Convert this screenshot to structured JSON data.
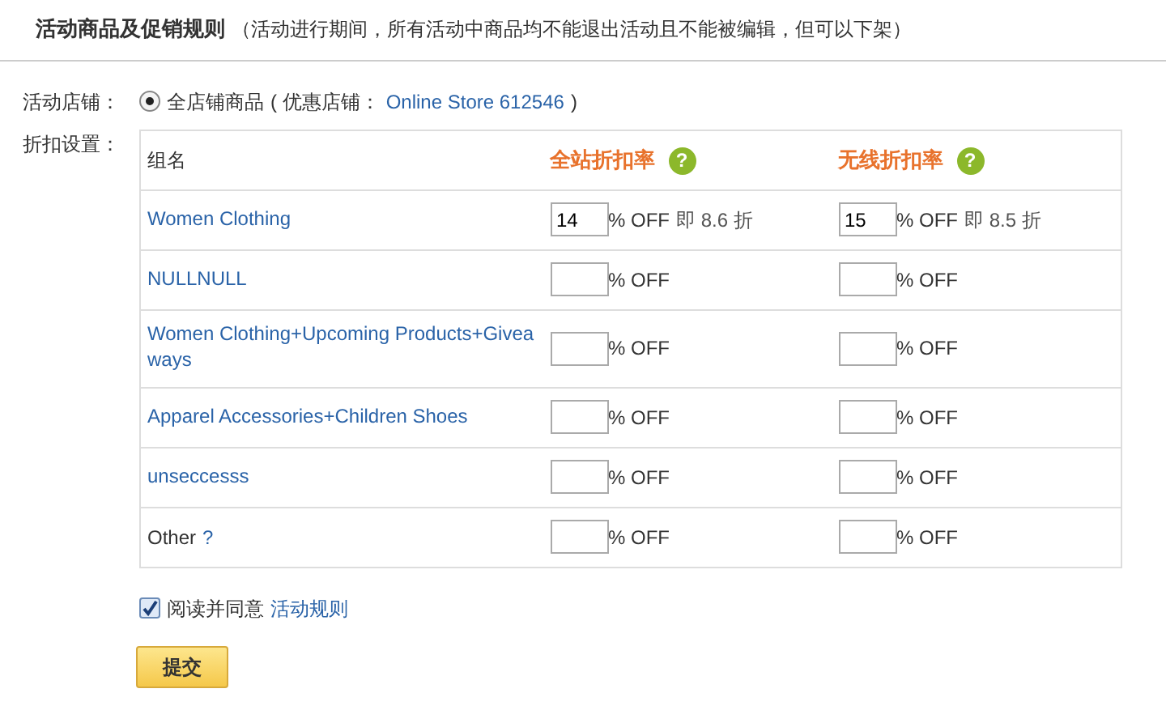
{
  "header": {
    "title": "活动商品及促销规则",
    "note": "（活动进行期间，所有活动中商品均不能退出活动且不能被编辑，但可以下架）"
  },
  "store": {
    "label": "活动店铺：",
    "option": {
      "label": "全店铺商品",
      "selected": true
    },
    "detail_prefix": "( 优惠店铺：",
    "store_link": "Online Store 612546",
    "detail_suffix": ")"
  },
  "discount": {
    "label": "折扣设置：",
    "columns": [
      {
        "label": "组名"
      },
      {
        "label": "全站折扣率",
        "help": "?"
      },
      {
        "label": "无线折扣率",
        "help": "?"
      }
    ],
    "rows": [
      {
        "name": "Women Clothing",
        "kind": "link",
        "rates": [
          {
            "value": "14",
            "unit": "% OFF",
            "note": "即 8.6 折"
          },
          {
            "value": "15",
            "unit": "% OFF",
            "note": "即 8.5 折"
          }
        ]
      },
      {
        "name": "NULLNULL",
        "kind": "link",
        "rates": [
          {
            "unit": "% OFF"
          },
          {
            "unit": "% OFF"
          }
        ]
      },
      {
        "name": "Women Clothing+Upcoming Products+Giveaways",
        "kind": "link",
        "rates": [
          {
            "unit": "% OFF"
          },
          {
            "unit": "% OFF"
          }
        ]
      },
      {
        "name": "Apparel Accessories+Children Shoes",
        "kind": "link",
        "rates": [
          {
            "unit": "% OFF"
          },
          {
            "unit": "% OFF"
          }
        ]
      },
      {
        "name": "unseccesss",
        "kind": "link",
        "rates": [
          {
            "unit": "% OFF"
          },
          {
            "unit": "% OFF"
          }
        ]
      },
      {
        "name": "Other",
        "kind": "plain",
        "help": "?",
        "rates": [
          {
            "unit": "% OFF"
          },
          {
            "unit": "% OFF"
          }
        ]
      }
    ]
  },
  "agree": {
    "checked": true,
    "label": "阅读并同意",
    "link": "活动规则"
  },
  "submit": "提交"
}
